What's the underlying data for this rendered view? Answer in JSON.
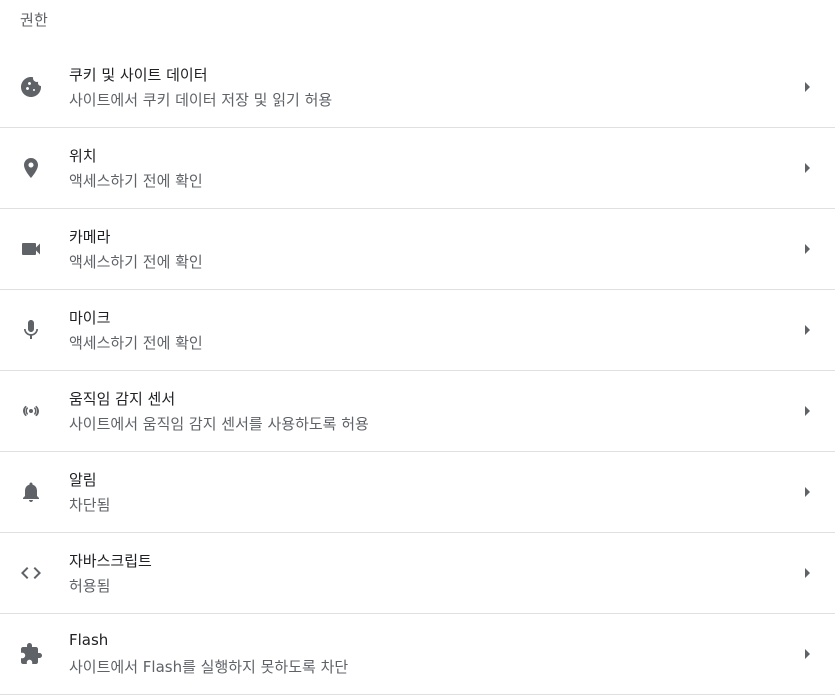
{
  "section": {
    "title": "권한"
  },
  "items": [
    {
      "key": "cookies",
      "icon": "cookie-icon",
      "label": "쿠키 및 사이트 데이터",
      "sublabel": "사이트에서 쿠키 데이터 저장 및 읽기 허용"
    },
    {
      "key": "location",
      "icon": "location-pin-icon",
      "label": "위치",
      "sublabel": "액세스하기 전에 확인"
    },
    {
      "key": "camera",
      "icon": "camera-icon",
      "label": "카메라",
      "sublabel": "액세스하기 전에 확인"
    },
    {
      "key": "microphone",
      "icon": "microphone-icon",
      "label": "마이크",
      "sublabel": "액세스하기 전에 확인"
    },
    {
      "key": "motion-sensors",
      "icon": "sensors-icon",
      "label": "움직임 감지 센서",
      "sublabel": "사이트에서 움직임 감지 센서를 사용하도록 허용"
    },
    {
      "key": "notifications",
      "icon": "bell-icon",
      "label": "알림",
      "sublabel": "차단됨"
    },
    {
      "key": "javascript",
      "icon": "code-icon",
      "label": "자바스크립트",
      "sublabel": "허용됨"
    },
    {
      "key": "flash",
      "icon": "puzzle-icon",
      "label": "Flash",
      "sublabel": "사이트에서 Flash를 실행하지 못하도록 차단"
    }
  ],
  "colors": {
    "text": "#202124",
    "secondary": "#5f6368",
    "divider": "#e0e0e0"
  }
}
